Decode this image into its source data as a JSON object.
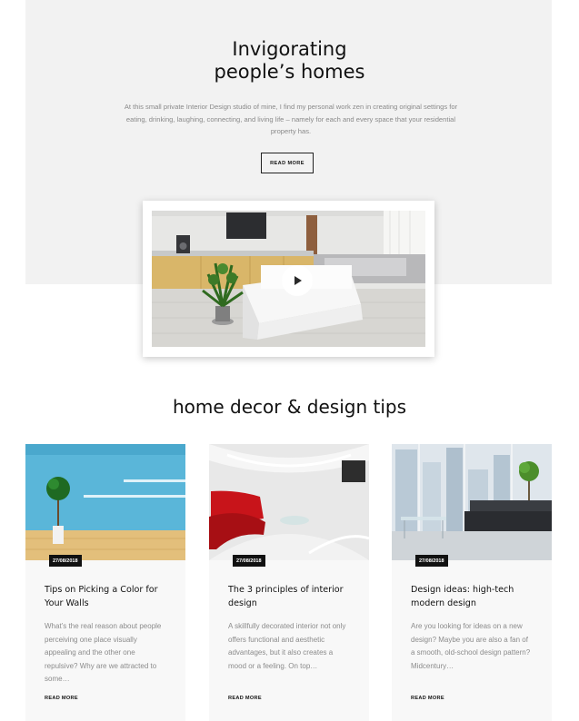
{
  "hero": {
    "title_line1": "Invigorating",
    "title_line2": "people’s homes",
    "description": "At this small private Interior Design studio of mine, I find my personal work zen in creating original settings for eating, drinking, laughing, connecting, and living life – namely for each and every space that your residential property has.",
    "button_label": "READ MORE",
    "video_icon": "play-icon"
  },
  "tips": {
    "section_title": "home decor & design tips",
    "posts": [
      {
        "date": "27/08/2018",
        "title": "Tips on Picking a Color for Your Walls",
        "excerpt": "What’s the real reason about people perceiving one place visually appealing and the other one repulsive? Why are we attracted to some…",
        "link_label": "READ MORE"
      },
      {
        "date": "27/08/2018",
        "title": "The 3 principles of interior design",
        "excerpt": "A skillfully decorated interior not only offers functional and aesthetic advantages, but it also creates a mood or a feeling. On top…",
        "link_label": "READ MORE"
      },
      {
        "date": "27/08/2018",
        "title": "Design ideas: high-tech modern design",
        "excerpt": "Are you looking for ideas on a new design? Maybe you are also a fan of a smooth, old-school design pattern? Midcentury…",
        "link_label": "READ MORE"
      }
    ]
  },
  "colors": {
    "hero_bg": "#f2f2f2",
    "card_bg": "#f8f8f8",
    "text_dark": "#111111",
    "text_muted": "#8a8a8a"
  }
}
